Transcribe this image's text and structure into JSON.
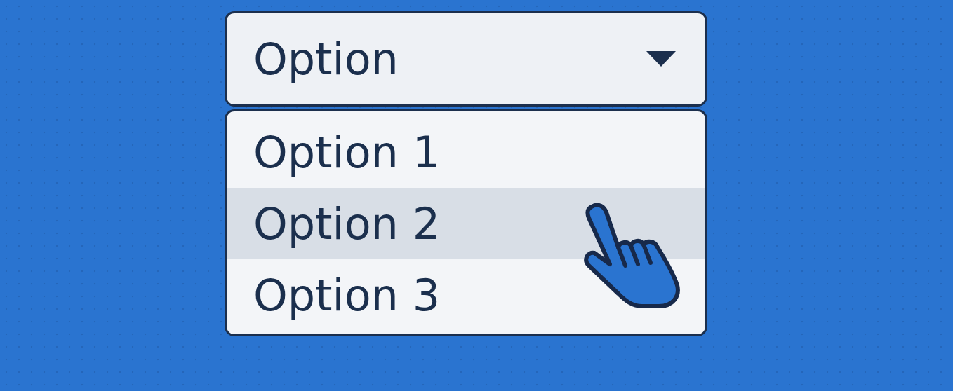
{
  "select": {
    "value": "Option",
    "expanded": true
  },
  "options": [
    {
      "label": "Option 1",
      "selected": false
    },
    {
      "label": "Option 2",
      "selected": true
    },
    {
      "label": "Option 3",
      "selected": false
    }
  ]
}
